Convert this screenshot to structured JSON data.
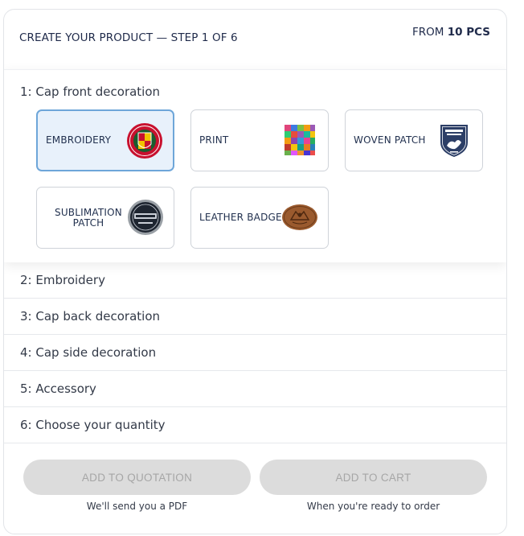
{
  "header": {
    "title": "CREATE YOUR PRODUCT — STEP 1 OF 6",
    "price_prefix": "FROM",
    "price_qty": "10 PCS"
  },
  "active_step": {
    "label": "1: Cap front decoration",
    "options": [
      {
        "label": "EMBROIDERY",
        "selected": true,
        "icon": "embroidery-badge-icon"
      },
      {
        "label": "PRINT",
        "selected": false,
        "icon": "print-mosaic-icon"
      },
      {
        "label": "WOVEN PATCH",
        "selected": false,
        "icon": "woven-shield-icon"
      },
      {
        "label": "SUBLIMATION PATCH",
        "selected": false,
        "icon": "sublimation-patch-icon"
      },
      {
        "label": "LEATHER BADGE",
        "selected": false,
        "icon": "leather-badge-icon"
      }
    ]
  },
  "steps": [
    {
      "label": "2: Embroidery"
    },
    {
      "label": "3: Cap back decoration"
    },
    {
      "label": "4: Cap side decoration"
    },
    {
      "label": "5: Accessory"
    },
    {
      "label": "6: Choose your quantity"
    }
  ],
  "actions": {
    "quotation_label": "ADD TO QUOTATION",
    "quotation_note": "We'll send you a PDF",
    "cart_label": "ADD TO CART",
    "cart_note": "When you're ready to order"
  },
  "colors": {
    "selected_bg": "#e8f1fb",
    "selected_border": "#6ea6d9",
    "text_dark": "#1f2a4a",
    "button_disabled": "#dcdcdc"
  }
}
